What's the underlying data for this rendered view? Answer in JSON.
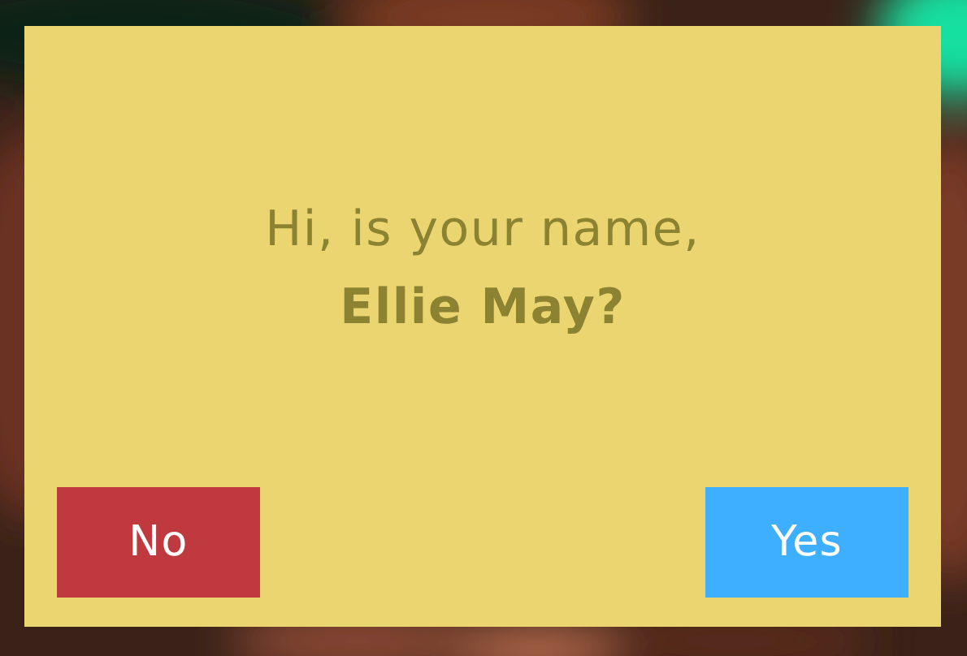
{
  "dialog": {
    "question": "Hi, is your name, **Ellie May?**",
    "buttons": [
      {
        "label": "No",
        "kind": "cancel"
      },
      {
        "label": "Yes",
        "kind": "confirm"
      }
    ]
  }
}
